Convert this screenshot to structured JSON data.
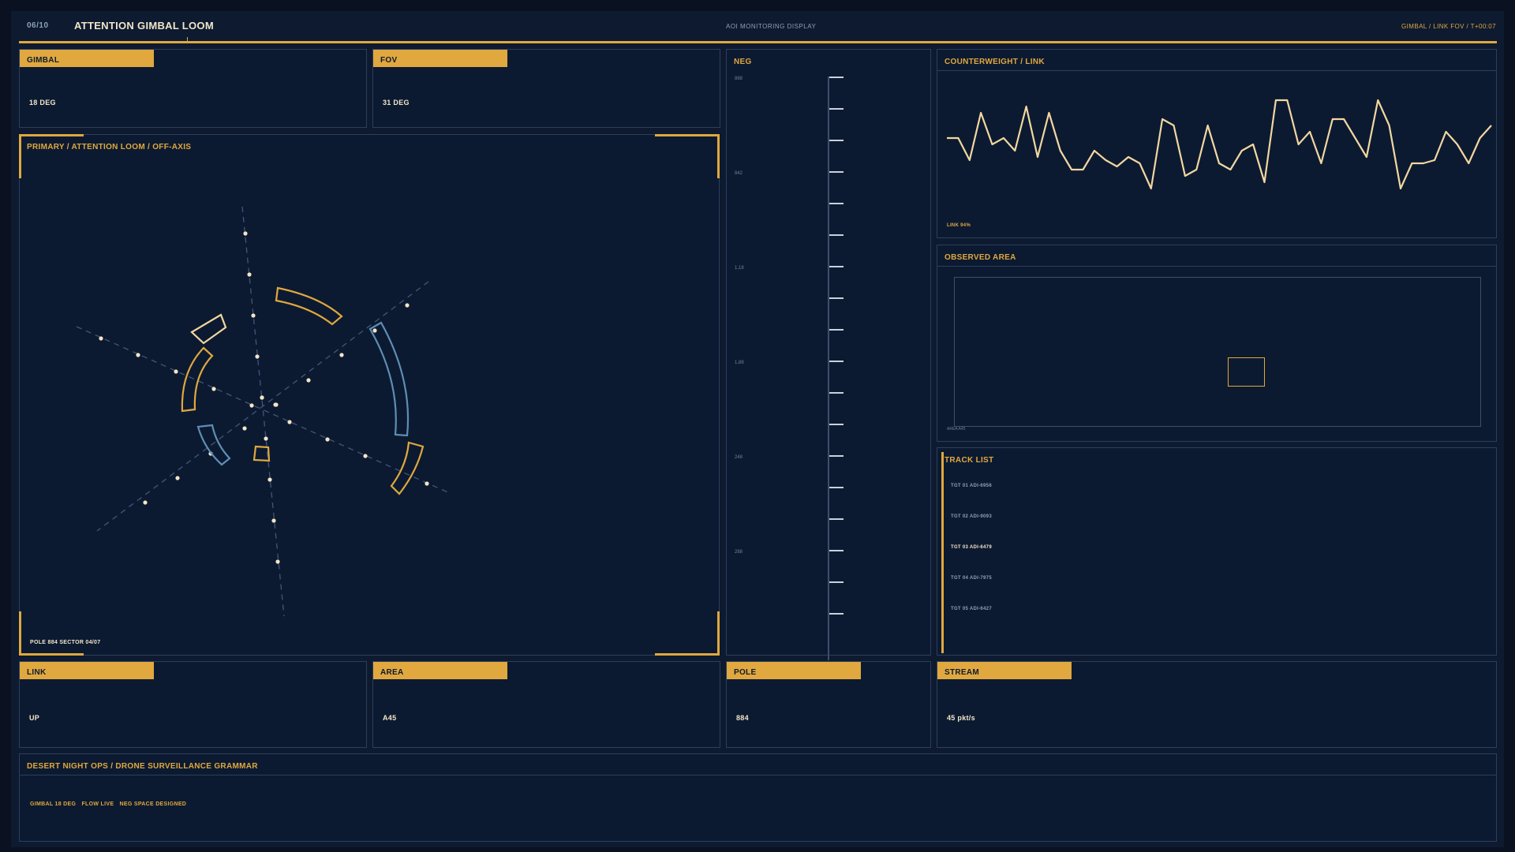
{
  "header": {
    "counter": "06/10",
    "title": "ATTENTION GIMBAL LOOM",
    "center_label": "AOI MONITORING DISPLAY",
    "right_label": "GIMBAL / LINK FOV / T+00:07"
  },
  "gimbal": {
    "label": "GIMBAL",
    "value": "18 DEG"
  },
  "fov": {
    "label": "FOV",
    "value": "31 DEG"
  },
  "neg": {
    "title": "NEG",
    "labels": [
      "888",
      "842",
      "1,18",
      "1,88",
      "248",
      "288"
    ]
  },
  "primary": {
    "title": "PRIMARY / ATTENTION LOOM / OFF-AXIS",
    "footer": "POLE 884  SECTOR 04/07"
  },
  "counterweight": {
    "title": "COUNTERWEIGHT / LINK",
    "caption": "LINK 94%",
    "series": [
      62,
      62,
      55,
      70,
      60,
      62,
      58,
      72,
      56,
      70,
      58,
      52,
      52,
      58,
      55,
      53,
      56,
      54,
      46,
      68,
      66,
      50,
      52,
      66,
      54,
      52,
      58,
      60,
      48,
      74,
      74,
      60,
      64,
      54,
      68,
      68,
      62,
      56,
      74,
      66,
      46,
      54,
      54,
      55,
      64,
      60,
      54,
      62,
      66
    ],
    "color": "#f2d7a0"
  },
  "observed_area": {
    "title": "OBSERVED AREA",
    "caption": "AREA A45"
  },
  "track_list": {
    "title": "TRACK LIST",
    "items": [
      {
        "label": "TGT 01  ADI-6956",
        "active": false
      },
      {
        "label": "TGT 02  ADI-9093",
        "active": false
      },
      {
        "label": "TGT 03  ADI-6479",
        "active": true
      },
      {
        "label": "TGT 04  ADI-7975",
        "active": false
      },
      {
        "label": "TGT 05  ADI-6427",
        "active": false
      }
    ]
  },
  "link": {
    "label": "LINK",
    "value": "UP"
  },
  "area": {
    "label": "AREA",
    "value": "A45"
  },
  "pole": {
    "label": "POLE",
    "value": "884"
  },
  "stream": {
    "label": "STREAM",
    "value": "45 pkt/s"
  },
  "footer": {
    "title": "DESERT NIGHT OPS / DRONE SURVEILLANCE GRAMMAR",
    "tags": [
      "GIMBAL 18 DEG",
      "FLOW LIVE",
      "NEG SPACE DESIGNED"
    ]
  },
  "colors": {
    "accent": "#e0a83e",
    "cream": "#f2e6c9",
    "steel_blue": "#5e8eb4",
    "panel_bg": "#0c1a31",
    "panel_border": "#2b3f5c"
  }
}
